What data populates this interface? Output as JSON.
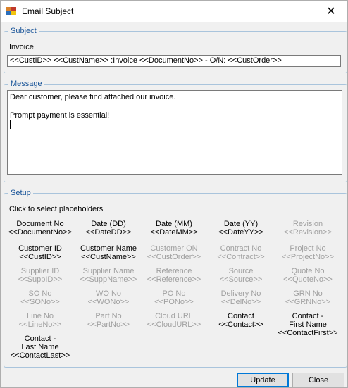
{
  "window": {
    "title": "Email Subject"
  },
  "subject": {
    "group_label": "Subject",
    "field_label": "Invoice",
    "value": "<<CustID>> <<CustName>> :Invoice <<DocumentNo>> - O/N: <<CustOrder>>"
  },
  "message": {
    "group_label": "Message",
    "lines": [
      "Dear customer, please find attached our invoice.",
      "",
      "Prompt payment is essential!"
    ]
  },
  "setup": {
    "group_label": "Setup",
    "hint": "Click to select placeholders",
    "placeholders": [
      {
        "name": "Document No",
        "token": "<<DocumentNo>>",
        "enabled": true
      },
      {
        "name": "Date (DD)",
        "token": "<<DateDD>>",
        "enabled": true
      },
      {
        "name": "Date (MM)",
        "token": "<<DateMM>>",
        "enabled": true
      },
      {
        "name": "Date (YY)",
        "token": "<<DateYY>>",
        "enabled": true
      },
      {
        "name": "Revision",
        "token": "<<Revision>>",
        "enabled": false
      },
      {
        "name": "Customer ID",
        "token": "<<CustID>>",
        "enabled": true
      },
      {
        "name": "Customer Name",
        "token": "<<CustName>>",
        "enabled": true
      },
      {
        "name": "Customer ON",
        "token": "<<CustOrder>>",
        "enabled": false
      },
      {
        "name": "Contract No",
        "token": "<<Contract>>",
        "enabled": false
      },
      {
        "name": "Project No",
        "token": "<<ProjectNo>>",
        "enabled": false
      },
      {
        "name": "Supplier ID",
        "token": "<<SuppID>>",
        "enabled": false
      },
      {
        "name": "Supplier Name",
        "token": "<<SuppName>>",
        "enabled": false
      },
      {
        "name": "Reference",
        "token": "<<Reference>>",
        "enabled": false
      },
      {
        "name": "Source",
        "token": "<<Source>>",
        "enabled": false
      },
      {
        "name": "Quote No",
        "token": "<<QuoteNo>>",
        "enabled": false
      },
      {
        "name": "SO No",
        "token": "<<SONo>>",
        "enabled": false
      },
      {
        "name": "WO No",
        "token": "<<WONo>>",
        "enabled": false
      },
      {
        "name": "PO No",
        "token": "<<PONo>>",
        "enabled": false
      },
      {
        "name": "Delivery No",
        "token": "<<DelNo>>",
        "enabled": false
      },
      {
        "name": "GRN No",
        "token": "<<GRNNo>>",
        "enabled": false
      },
      {
        "name": "Line No",
        "token": "<<LineNo>>",
        "enabled": false
      },
      {
        "name": "Part No",
        "token": "<<PartNo>>",
        "enabled": false
      },
      {
        "name": "Cloud URL",
        "token": "<<CloudURL>>",
        "enabled": false
      },
      {
        "name": "Contact",
        "token": "<<Contact>>",
        "enabled": true
      },
      {
        "name": "Contact -\nFirst Name",
        "token": "<<ContactFirst>>",
        "enabled": true
      },
      {
        "name": "Contact -\nLast Name",
        "token": "<<ContactLast>>",
        "enabled": true
      }
    ]
  },
  "buttons": {
    "update": "Update",
    "close": "Close"
  },
  "icons": {
    "app": "app-icon",
    "close": "close-icon"
  }
}
